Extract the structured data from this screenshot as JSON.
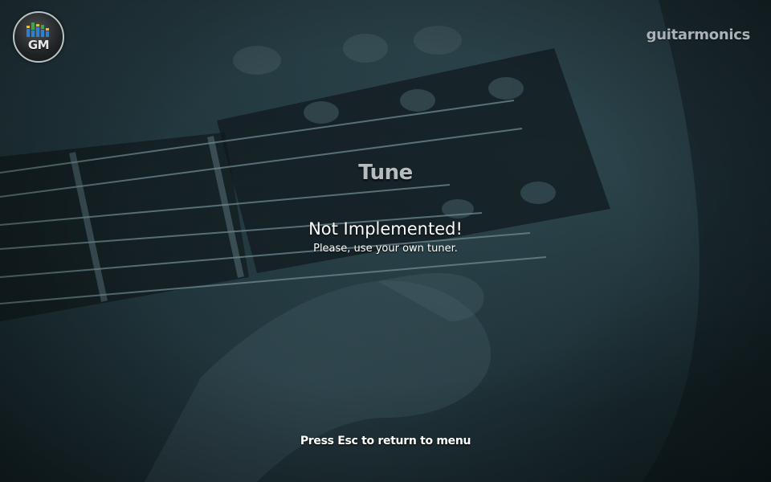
{
  "app": {
    "logo_text": "GM",
    "brand_name": "guitarmonics"
  },
  "screen": {
    "title": "Tune",
    "message_heading": "Not Implemented!",
    "message_sub": "Please, use your own tuner.",
    "footer_hint": "Press Esc to return to menu"
  },
  "colors": {
    "background": "#1d3137",
    "text_primary": "#ffffff",
    "title_text": "#b7bcbf",
    "brand_text": "#a9b2b6",
    "logo_bars": [
      "#3fa34a",
      "#e2c23a",
      "#2f7fd0"
    ]
  },
  "background_image": "guitar-headstock-photo"
}
